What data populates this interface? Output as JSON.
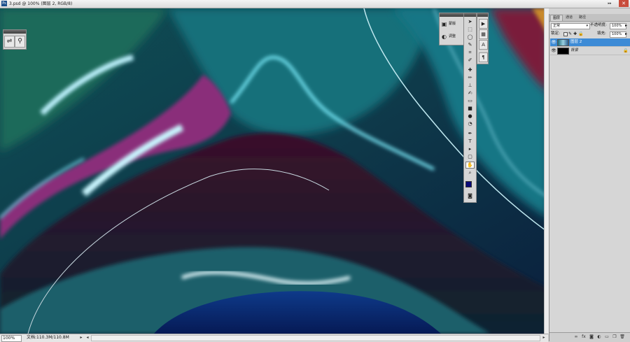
{
  "document": {
    "title": "3.psd @ 100% (图层 2, RGB/8)",
    "zoom": "100%",
    "doc_info": "文档:110.3M/110.8M",
    "icon": "photoshop-doc-icon"
  },
  "mini_panel": {
    "items": [
      {
        "icon": "adjust-sliders-icon"
      },
      {
        "icon": "plug-icon"
      }
    ]
  },
  "adjust_panel": {
    "items": [
      {
        "label": "蒙版",
        "icon": "mask-icon"
      },
      {
        "label": "调整",
        "icon": "adjust-circle-icon"
      }
    ]
  },
  "tools": [
    "move",
    "marquee",
    "lasso",
    "quick-select",
    "crop",
    "eyedropper",
    "healing",
    "brush",
    "stamp",
    "history-brush",
    "eraser",
    "gradient",
    "blur",
    "dodge",
    "pen",
    "type",
    "path-select",
    "shape",
    "hand",
    "zoom"
  ],
  "side_tools": [
    "history",
    "actions",
    "character",
    "paragraph"
  ],
  "colors": {
    "foreground": "#0a0a78",
    "background": "#ffffff",
    "selection": "#3d8bd6"
  },
  "layers_panel": {
    "tabs": [
      "图层",
      "通道",
      "路径"
    ],
    "active_tab": 0,
    "blend_mode": "正常",
    "opacity_label": "不透明度:",
    "opacity": "100%",
    "lock_label": "锁定:",
    "fill_label": "填充:",
    "fill": "100%",
    "layers": [
      {
        "name": "图层 2",
        "selected": true,
        "locked": false
      },
      {
        "name": "背景",
        "selected": false,
        "locked": true
      }
    ]
  }
}
